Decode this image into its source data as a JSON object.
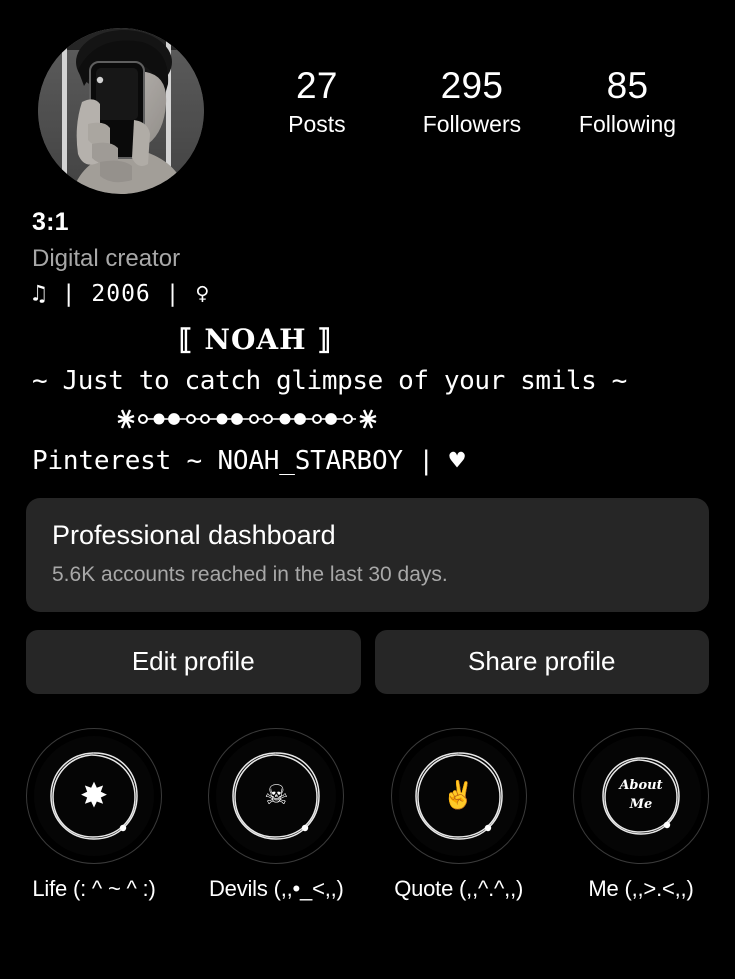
{
  "profile": {
    "avatar_alt": "black and white mirror selfie holding phone",
    "username": "3:1",
    "category": "Digital creator",
    "bio_line_1": "♫ | 2006 | ♀",
    "bio_title": "⟦ NOAH ⟧",
    "bio_quote": "~ Just to catch glimpse of your smils ~",
    "bio_social": "Pinterest ~ NOAH_STARBOY | ♥"
  },
  "stats": [
    {
      "value": "27",
      "label": "Posts"
    },
    {
      "value": "295",
      "label": "Followers"
    },
    {
      "value": "85",
      "label": "Following"
    }
  ],
  "dashboard": {
    "title": "Professional dashboard",
    "subtitle": "5.6K accounts reached in the last 30 days."
  },
  "actions": {
    "edit_label": "Edit profile",
    "share_label": "Share profile"
  },
  "highlights": [
    {
      "label": "Life (: ^ ~ ^ :)",
      "icon": "flower-asterisk-icon",
      "glyph": "✸"
    },
    {
      "label": "Devils (,,•_<,,)",
      "icon": "skull-crossbones-icon",
      "glyph": "☠"
    },
    {
      "label": "Quote (,,^.^,,)",
      "icon": "victory-hand-icon",
      "glyph": "✌"
    },
    {
      "label": "Me (,,>.<,,)",
      "icon": "about-me-text-icon",
      "glyph": "About\nMe"
    }
  ],
  "colors": {
    "background": "#000000",
    "card": "#262626",
    "text_primary": "#ffffff",
    "text_secondary": "#a8a8a8",
    "ring": "#3a3a3a"
  }
}
